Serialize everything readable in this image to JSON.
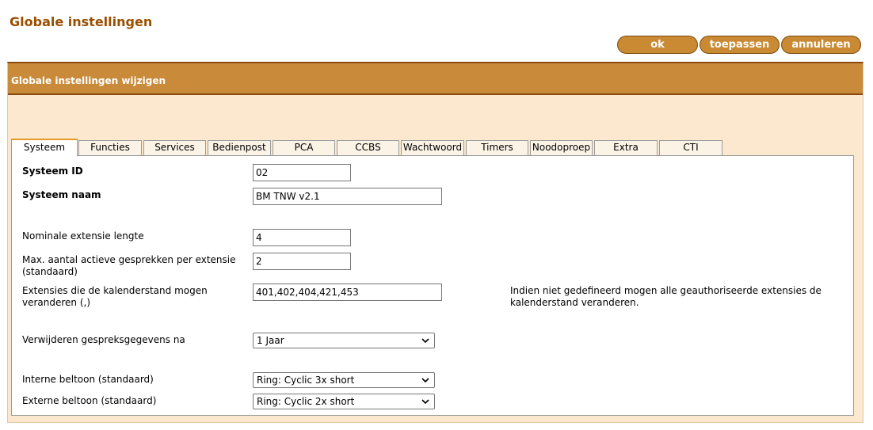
{
  "page": {
    "title": "Globale instellingen"
  },
  "buttons": {
    "ok": "ok",
    "apply": "toepassen",
    "cancel": "annuleren"
  },
  "panel": {
    "header": "Globale instellingen wijzigen"
  },
  "tabs": [
    {
      "label": "Systeem",
      "active": true
    },
    {
      "label": "Functies"
    },
    {
      "label": "Services"
    },
    {
      "label": "Bedienpost"
    },
    {
      "label": "PCA"
    },
    {
      "label": "CCBS"
    },
    {
      "label": "Wachtwoord"
    },
    {
      "label": "Timers"
    },
    {
      "label": "Noodoproep"
    },
    {
      "label": "Extra"
    },
    {
      "label": "CTI"
    }
  ],
  "form": {
    "system_id": {
      "label": "Systeem ID",
      "value": "02"
    },
    "system_name": {
      "label": "Systeem naam",
      "value": "BM TNW v2.1"
    },
    "ext_length": {
      "label": "Nominale extensie lengte",
      "value": "4"
    },
    "max_calls": {
      "label": "Max. aantal actieve gesprekken per extensie (standaard)",
      "value": "2"
    },
    "calendar_ext": {
      "label": "Extensies die de kalenderstand mogen veranderen (,)",
      "value": "401,402,404,421,453",
      "note": "Indien niet gedefineerd mogen alle geauthoriseerde extensies de kalenderstand veranderen."
    },
    "delete_records": {
      "label": "Verwijderen gespreksgegevens na",
      "value": "1 Jaar"
    },
    "internal_ring": {
      "label": "Interne beltoon (standaard)",
      "value": "Ring: Cyclic 3x short"
    },
    "external_ring": {
      "label": "Externe beltoon (standaard)",
      "value": "Ring: Cyclic 2x short"
    }
  },
  "colors": {
    "brand": "#9a4f00",
    "accent": "#c98a33",
    "panel_bg": "#fbe8cf",
    "tab_active": "#e49b25"
  }
}
